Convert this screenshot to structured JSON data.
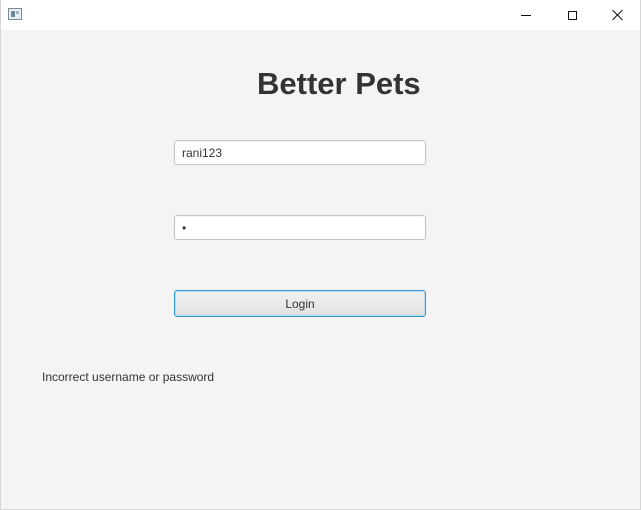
{
  "window": {
    "icon": "app-window-icon",
    "controls": {
      "minimize_icon": "minimize-icon",
      "maximize_icon": "maximize-icon",
      "close_icon": "close-icon"
    }
  },
  "login": {
    "title": "Better Pets",
    "username": {
      "value": "rani123",
      "placeholder": ""
    },
    "password": {
      "value": "•",
      "placeholder": ""
    },
    "button_label": "Login",
    "error_message": "Incorrect username or password"
  },
  "colors": {
    "background": "#f4f4f4",
    "titlebar": "#ffffff",
    "text": "#333333",
    "field_border": "#c4c4c4",
    "focus_border": "#2f9bd6"
  }
}
